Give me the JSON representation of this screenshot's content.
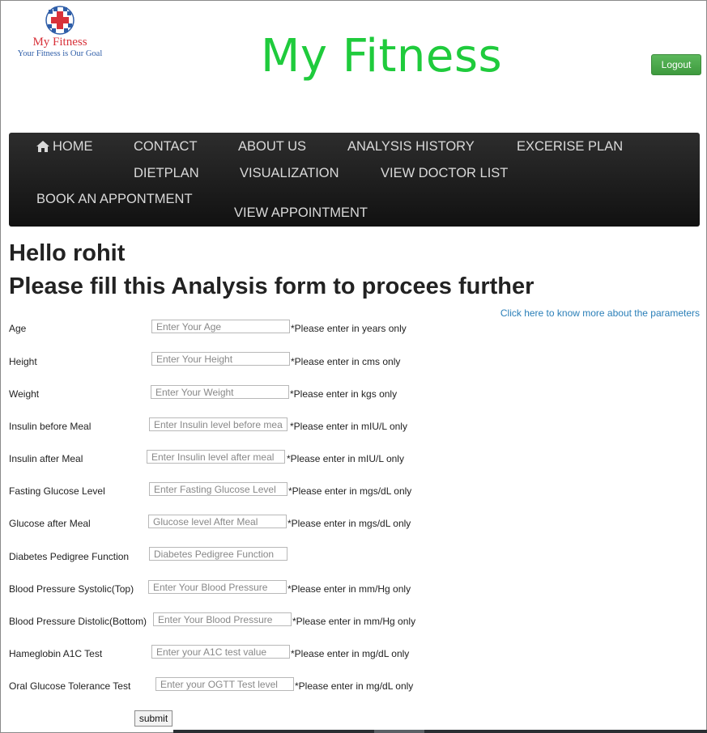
{
  "logo": {
    "name": "My Fitness",
    "tagline": "Your Fitness is Our Goal"
  },
  "header": {
    "title": "My Fitness",
    "logout_label": "Logout"
  },
  "nav": {
    "items": [
      {
        "label": "HOME",
        "icon": "home-icon"
      },
      {
        "label": "CONTACT"
      },
      {
        "label": "ABOUT US"
      },
      {
        "label": "ANALYSIS HISTORY"
      },
      {
        "label": "EXCERISE PLAN"
      },
      {
        "label": "DIETPLAN"
      },
      {
        "label": "VISUALIZATION"
      },
      {
        "label": "VIEW DOCTOR LIST"
      },
      {
        "label": "BOOK AN APPONTMENT"
      },
      {
        "label": "VIEW APPOINTMENT"
      }
    ]
  },
  "main": {
    "greeting": "Hello rohit",
    "form_title": "Please fill this Analysis form to procees further",
    "params_link": "Click here to know more about the parameters",
    "fields": [
      {
        "label": "Age",
        "placeholder": "Enter Your Age",
        "value": "",
        "hint": "*Please enter in years only"
      },
      {
        "label": "Height",
        "placeholder": "Enter Your Height",
        "value": "",
        "hint": "*Please enter in cms only"
      },
      {
        "label": "Weight",
        "placeholder": "Enter Your Weight",
        "value": "",
        "hint": "*Please enter in kgs only"
      },
      {
        "label": "Insulin before Meal",
        "placeholder": "Enter Insulin level before meal",
        "value": "",
        "hint": "*Please enter in mIU/L only"
      },
      {
        "label": "Insulin after Meal",
        "placeholder": "Enter Insulin level after meal",
        "value": "",
        "hint": "*Please enter in mIU/L only"
      },
      {
        "label": "Fasting Glucose Level",
        "placeholder": "Enter Fasting Glucose Level",
        "value": "",
        "hint": "*Please enter in mgs/dL only"
      },
      {
        "label": "Glucose after Meal",
        "placeholder": "Glucose level After Meal",
        "value": "",
        "hint": "*Please enter in mgs/dL only"
      },
      {
        "label": "Diabetes Pedigree Function",
        "placeholder": "Diabetes Pedigree Function",
        "value": "",
        "hint": ""
      },
      {
        "label": "Blood Pressure Systolic(Top)",
        "placeholder": "Enter Your Blood Pressure",
        "value": "",
        "hint": "*Please enter in mm/Hg only"
      },
      {
        "label": "Blood Pressure Distolic(Bottom)",
        "placeholder": "Enter Your Blood Pressure",
        "value": "",
        "hint": "*Please enter in mm/Hg only"
      },
      {
        "label": "Hameglobin A1C Test",
        "placeholder": "Enter your A1C test value",
        "value": "",
        "hint": "*Please enter in mg/dL only"
      },
      {
        "label": "Oral Glucose Tolerance Test",
        "placeholder": "Enter your OGTT Test level",
        "value": "",
        "hint": "*Please enter in mg/dL only"
      }
    ],
    "submit_label": "submit"
  },
  "colors": {
    "title_green": "#1fcb3c",
    "logout_green": "#4cae4c",
    "navbar_dark": "#1c1c1c",
    "link_blue": "#2a7fb8",
    "logo_red": "#d8323a",
    "logo_blue": "#2f5ea8"
  }
}
